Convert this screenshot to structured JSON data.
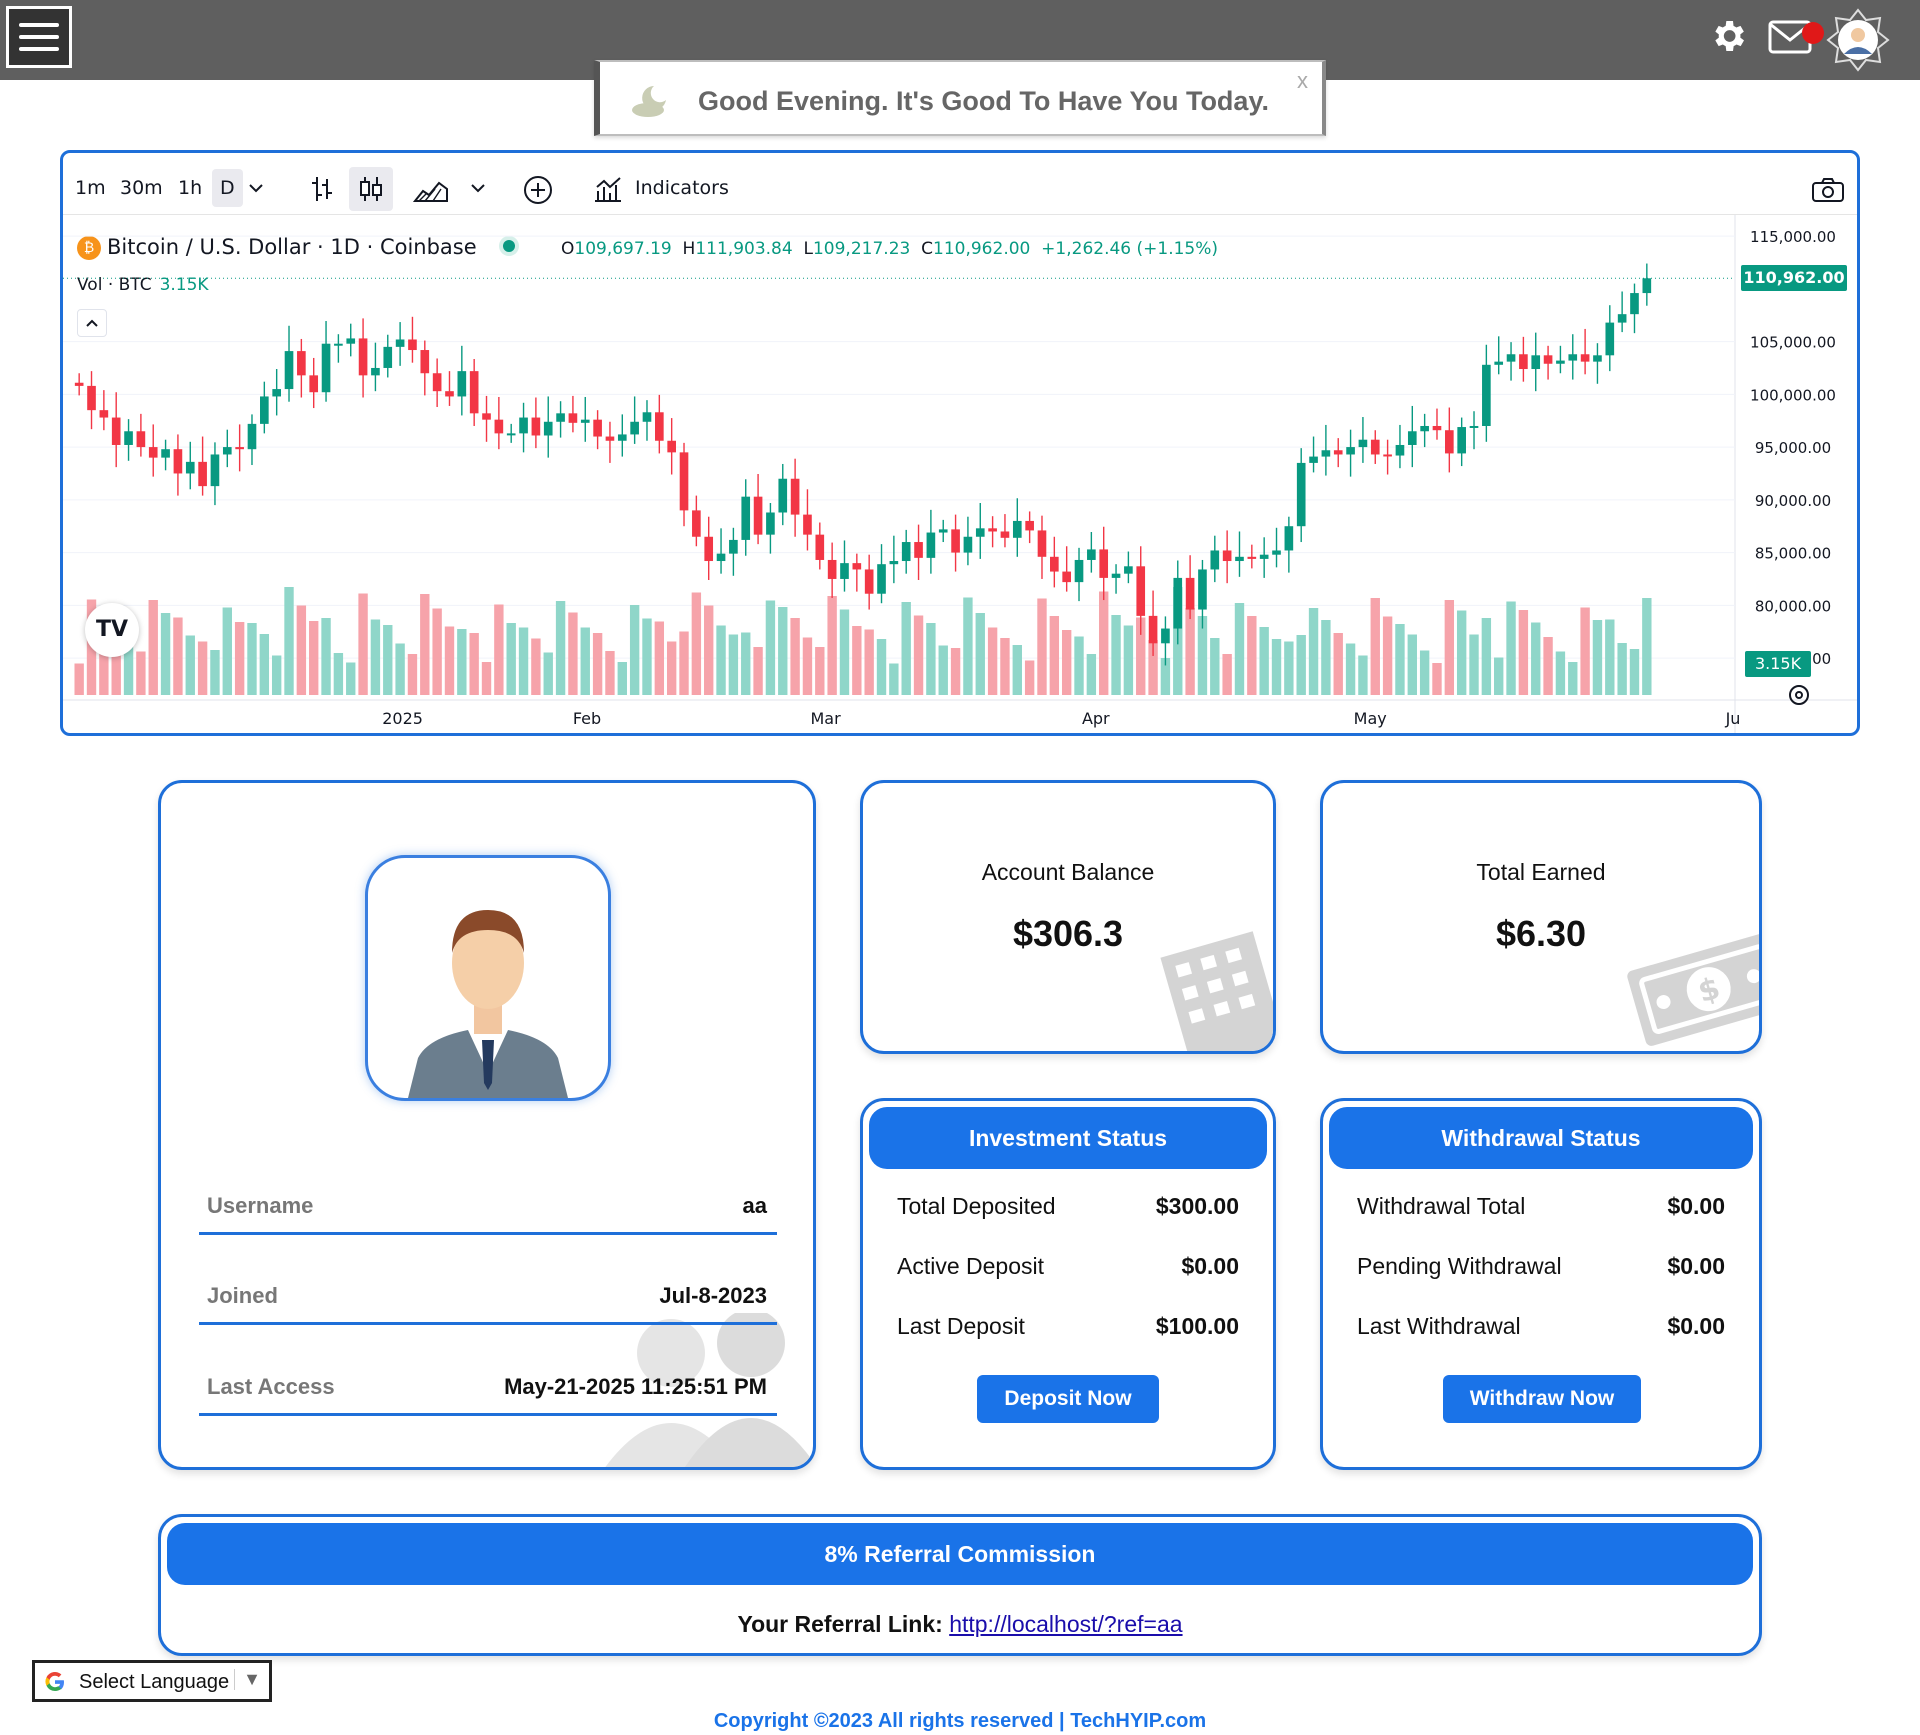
{
  "topbar": {
    "menu_icon": "hamburger-menu-icon",
    "settings_icon": "gear-icon",
    "mail_icon": "envelope-icon",
    "avatar_icon": "user-avatar-icon"
  },
  "greeting": {
    "text": "Good Evening. It's Good To Have You Today.",
    "close": "x",
    "icon": "moon-cloud-icon"
  },
  "chart_widget": {
    "timeframes": [
      "1m",
      "30m",
      "1h",
      "D"
    ],
    "selected_timeframe": "D",
    "indicators_label": "Indicators",
    "symbol": "Bitcoin / U.S. Dollar · 1D · Coinbase",
    "ohlc": {
      "o_label": "O",
      "o": "109,697.19",
      "h_label": "H",
      "h": "111,903.84",
      "l_label": "L",
      "l": "109,217.23",
      "c_label": "C",
      "c": "110,962.00",
      "change": "+1,262.46 (+1.15%)"
    },
    "volume": {
      "label": "Vol · BTC",
      "value": "3.15K"
    },
    "price_badge": "110,962.00",
    "volume_badge": "3.15K",
    "colors": {
      "up": "#089981",
      "down": "#f23645",
      "accent": "#1e6fd9"
    }
  },
  "chart_data": {
    "type": "candlestick",
    "title": "Bitcoin / U.S. Dollar · 1D · Coinbase",
    "y_ticks": [
      "115,000.00",
      "105,000.00",
      "100,000.00",
      "95,000.00",
      "90,000.00",
      "85,000.00",
      "80,000.00",
      "75,000.00"
    ],
    "y_tick_values": [
      115000,
      105000,
      100000,
      95000,
      90000,
      85000,
      80000,
      75000
    ],
    "x_ticks": [
      "2025",
      "Feb",
      "Mar",
      "Apr",
      "May",
      "Ju"
    ],
    "ylim": [
      71500,
      117000
    ],
    "series": [
      {
        "name": "BTC/USD",
        "points": "daily close approx",
        "close": [
          100800,
          98500,
          97800,
          95200,
          96500,
          95000,
          94000,
          94800,
          92500,
          93600,
          91300,
          94300,
          95000,
          94800,
          97200,
          99800,
          100500,
          104100,
          101800,
          100200,
          104800,
          104800,
          105300,
          101800,
          102500,
          104500,
          105200,
          104200,
          102000,
          100300,
          99800,
          102200,
          98200,
          97600,
          96300,
          96300,
          97800,
          96100,
          97400,
          98200,
          97300,
          97600,
          96000,
          95600,
          96200,
          97400,
          98300,
          95600,
          94500,
          89000,
          86500,
          84200,
          84900,
          86200,
          90300,
          86700,
          88800,
          92000,
          88600,
          86700,
          84300,
          82500,
          84000,
          83400,
          81100,
          83900,
          84200,
          86000,
          84500,
          86900,
          87200,
          85000,
          86500,
          87300,
          87000,
          86400,
          88000,
          87100,
          84600,
          83200,
          82200,
          84300,
          85300,
          82600,
          83000,
          83700,
          79000,
          76400,
          77800,
          82600,
          79600,
          83400,
          85200,
          84200,
          84600,
          84400,
          84800,
          85200,
          87500,
          93500,
          94100,
          94700,
          94300,
          95000,
          95700,
          94300,
          94200,
          95200,
          96500,
          97000,
          96600,
          94400,
          96900,
          97000,
          102800,
          103100,
          103800,
          102400,
          103700,
          102900,
          103200,
          103800,
          103100,
          103700,
          106800,
          107600,
          109600,
          111000
        ]
      }
    ],
    "volume_series_values_btc": "relative bars, latest 3.15K",
    "grid": true,
    "legend": "top-left"
  },
  "profile": {
    "avatar_icon": "businessman-avatar-icon",
    "rows": [
      {
        "label": "Username",
        "value": "aa"
      },
      {
        "label": "Joined",
        "value": "Jul-8-2023"
      },
      {
        "label": "Last Access",
        "value": "May-21-2025 11:25:51 PM"
      }
    ]
  },
  "balance_card": {
    "label": "Account Balance",
    "value": "$306.3",
    "icon": "building-icon"
  },
  "earned_card": {
    "label": "Total Earned",
    "value": "$6.30",
    "icon": "money-bill-icon"
  },
  "investment": {
    "title": "Investment Status",
    "rows": [
      {
        "label": "Total Deposited",
        "value": "$300.00"
      },
      {
        "label": "Active Deposit",
        "value": "$0.00"
      },
      {
        "label": "Last Deposit",
        "value": "$100.00"
      }
    ],
    "button": "Deposit Now"
  },
  "withdrawal": {
    "title": "Withdrawal Status",
    "rows": [
      {
        "label": "Withdrawal Total",
        "value": "$0.00"
      },
      {
        "label": "Pending Withdrawal",
        "value": "$0.00"
      },
      {
        "label": "Last Withdrawal",
        "value": "$0.00"
      }
    ],
    "button": "Withdraw Now"
  },
  "referral": {
    "title": "8% Referral Commission",
    "link_label": "Your Referral Link:",
    "link": "http://localhost/?ref=aa"
  },
  "language": {
    "label": "Select Language",
    "arrow": "▼",
    "icon": "google-g-icon"
  },
  "footer": {
    "text": "Copyright ©2023 All rights reserved | TechHYIP.com"
  }
}
